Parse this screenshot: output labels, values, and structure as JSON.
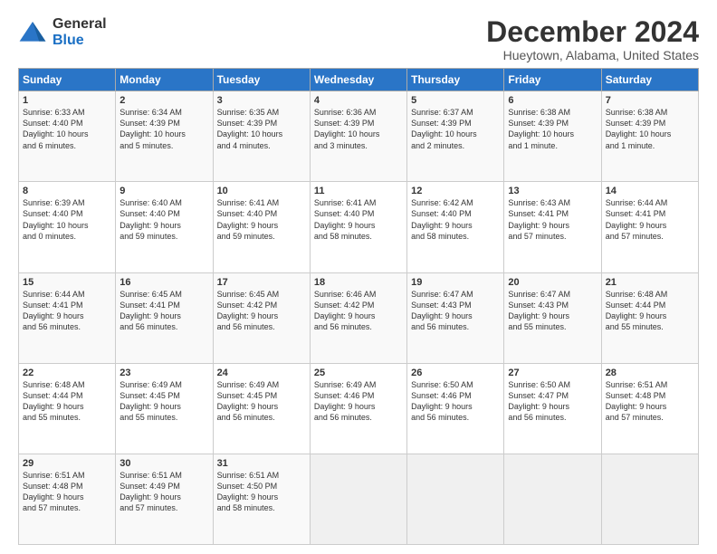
{
  "logo": {
    "general": "General",
    "blue": "Blue"
  },
  "title": "December 2024",
  "subtitle": "Hueytown, Alabama, United States",
  "days_of_week": [
    "Sunday",
    "Monday",
    "Tuesday",
    "Wednesday",
    "Thursday",
    "Friday",
    "Saturday"
  ],
  "weeks": [
    [
      {
        "day": 1,
        "content": "Sunrise: 6:33 AM\nSunset: 4:40 PM\nDaylight: 10 hours\nand 6 minutes."
      },
      {
        "day": 2,
        "content": "Sunrise: 6:34 AM\nSunset: 4:39 PM\nDaylight: 10 hours\nand 5 minutes."
      },
      {
        "day": 3,
        "content": "Sunrise: 6:35 AM\nSunset: 4:39 PM\nDaylight: 10 hours\nand 4 minutes."
      },
      {
        "day": 4,
        "content": "Sunrise: 6:36 AM\nSunset: 4:39 PM\nDaylight: 10 hours\nand 3 minutes."
      },
      {
        "day": 5,
        "content": "Sunrise: 6:37 AM\nSunset: 4:39 PM\nDaylight: 10 hours\nand 2 minutes."
      },
      {
        "day": 6,
        "content": "Sunrise: 6:38 AM\nSunset: 4:39 PM\nDaylight: 10 hours\nand 1 minute."
      },
      {
        "day": 7,
        "content": "Sunrise: 6:38 AM\nSunset: 4:39 PM\nDaylight: 10 hours\nand 1 minute."
      }
    ],
    [
      {
        "day": 8,
        "content": "Sunrise: 6:39 AM\nSunset: 4:40 PM\nDaylight: 10 hours\nand 0 minutes."
      },
      {
        "day": 9,
        "content": "Sunrise: 6:40 AM\nSunset: 4:40 PM\nDaylight: 9 hours\nand 59 minutes."
      },
      {
        "day": 10,
        "content": "Sunrise: 6:41 AM\nSunset: 4:40 PM\nDaylight: 9 hours\nand 59 minutes."
      },
      {
        "day": 11,
        "content": "Sunrise: 6:41 AM\nSunset: 4:40 PM\nDaylight: 9 hours\nand 58 minutes."
      },
      {
        "day": 12,
        "content": "Sunrise: 6:42 AM\nSunset: 4:40 PM\nDaylight: 9 hours\nand 58 minutes."
      },
      {
        "day": 13,
        "content": "Sunrise: 6:43 AM\nSunset: 4:41 PM\nDaylight: 9 hours\nand 57 minutes."
      },
      {
        "day": 14,
        "content": "Sunrise: 6:44 AM\nSunset: 4:41 PM\nDaylight: 9 hours\nand 57 minutes."
      }
    ],
    [
      {
        "day": 15,
        "content": "Sunrise: 6:44 AM\nSunset: 4:41 PM\nDaylight: 9 hours\nand 56 minutes."
      },
      {
        "day": 16,
        "content": "Sunrise: 6:45 AM\nSunset: 4:41 PM\nDaylight: 9 hours\nand 56 minutes."
      },
      {
        "day": 17,
        "content": "Sunrise: 6:45 AM\nSunset: 4:42 PM\nDaylight: 9 hours\nand 56 minutes."
      },
      {
        "day": 18,
        "content": "Sunrise: 6:46 AM\nSunset: 4:42 PM\nDaylight: 9 hours\nand 56 minutes."
      },
      {
        "day": 19,
        "content": "Sunrise: 6:47 AM\nSunset: 4:43 PM\nDaylight: 9 hours\nand 56 minutes."
      },
      {
        "day": 20,
        "content": "Sunrise: 6:47 AM\nSunset: 4:43 PM\nDaylight: 9 hours\nand 55 minutes."
      },
      {
        "day": 21,
        "content": "Sunrise: 6:48 AM\nSunset: 4:44 PM\nDaylight: 9 hours\nand 55 minutes."
      }
    ],
    [
      {
        "day": 22,
        "content": "Sunrise: 6:48 AM\nSunset: 4:44 PM\nDaylight: 9 hours\nand 55 minutes."
      },
      {
        "day": 23,
        "content": "Sunrise: 6:49 AM\nSunset: 4:45 PM\nDaylight: 9 hours\nand 55 minutes."
      },
      {
        "day": 24,
        "content": "Sunrise: 6:49 AM\nSunset: 4:45 PM\nDaylight: 9 hours\nand 56 minutes."
      },
      {
        "day": 25,
        "content": "Sunrise: 6:49 AM\nSunset: 4:46 PM\nDaylight: 9 hours\nand 56 minutes."
      },
      {
        "day": 26,
        "content": "Sunrise: 6:50 AM\nSunset: 4:46 PM\nDaylight: 9 hours\nand 56 minutes."
      },
      {
        "day": 27,
        "content": "Sunrise: 6:50 AM\nSunset: 4:47 PM\nDaylight: 9 hours\nand 56 minutes."
      },
      {
        "day": 28,
        "content": "Sunrise: 6:51 AM\nSunset: 4:48 PM\nDaylight: 9 hours\nand 57 minutes."
      }
    ],
    [
      {
        "day": 29,
        "content": "Sunrise: 6:51 AM\nSunset: 4:48 PM\nDaylight: 9 hours\nand 57 minutes."
      },
      {
        "day": 30,
        "content": "Sunrise: 6:51 AM\nSunset: 4:49 PM\nDaylight: 9 hours\nand 57 minutes."
      },
      {
        "day": 31,
        "content": "Sunrise: 6:51 AM\nSunset: 4:50 PM\nDaylight: 9 hours\nand 58 minutes."
      },
      null,
      null,
      null,
      null
    ]
  ]
}
